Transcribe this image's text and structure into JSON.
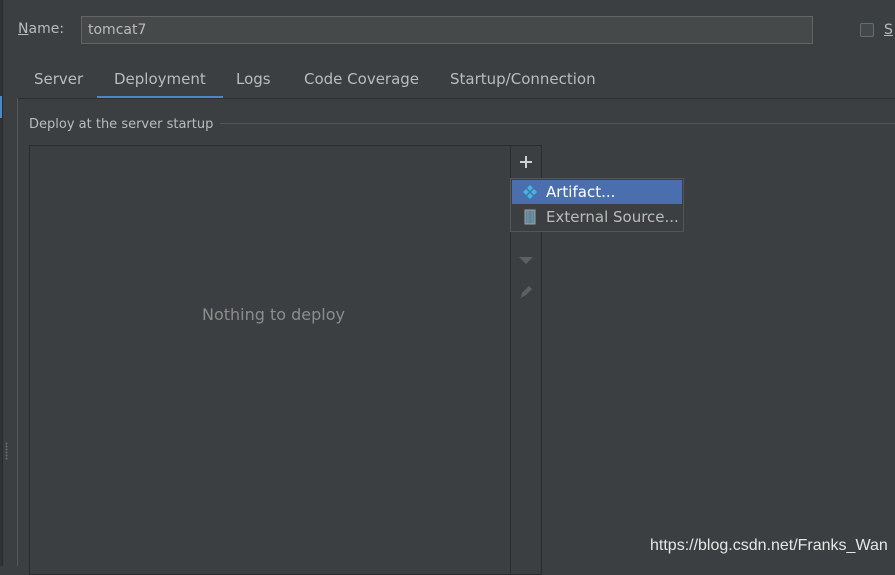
{
  "form": {
    "name_label_first": "N",
    "name_label_rest": "ame:",
    "name_value": "tomcat7",
    "share_label": "S"
  },
  "tabs": [
    {
      "label": "Server"
    },
    {
      "label": "Deployment"
    },
    {
      "label": "Logs"
    },
    {
      "label": "Code Coverage"
    },
    {
      "label": "Startup/Connection"
    }
  ],
  "deployment": {
    "group_title": "Deploy at the server startup",
    "empty_text": "Nothing to deploy",
    "toolbar": {
      "add_icon": "plus-icon",
      "move_down_icon": "arrow-down-icon",
      "edit_icon": "pencil-icon"
    }
  },
  "popup": {
    "items": [
      {
        "label": "Artifact...",
        "icon": "artifact-icon",
        "selected": true
      },
      {
        "label": "External Source...",
        "icon": "external-source-icon",
        "selected": false
      }
    ]
  },
  "watermark": "https://blog.csdn.net/Franks_Wan",
  "colors": {
    "background": "#3c3f41",
    "accent": "#4a88c7",
    "selection": "#4b6eaf"
  }
}
